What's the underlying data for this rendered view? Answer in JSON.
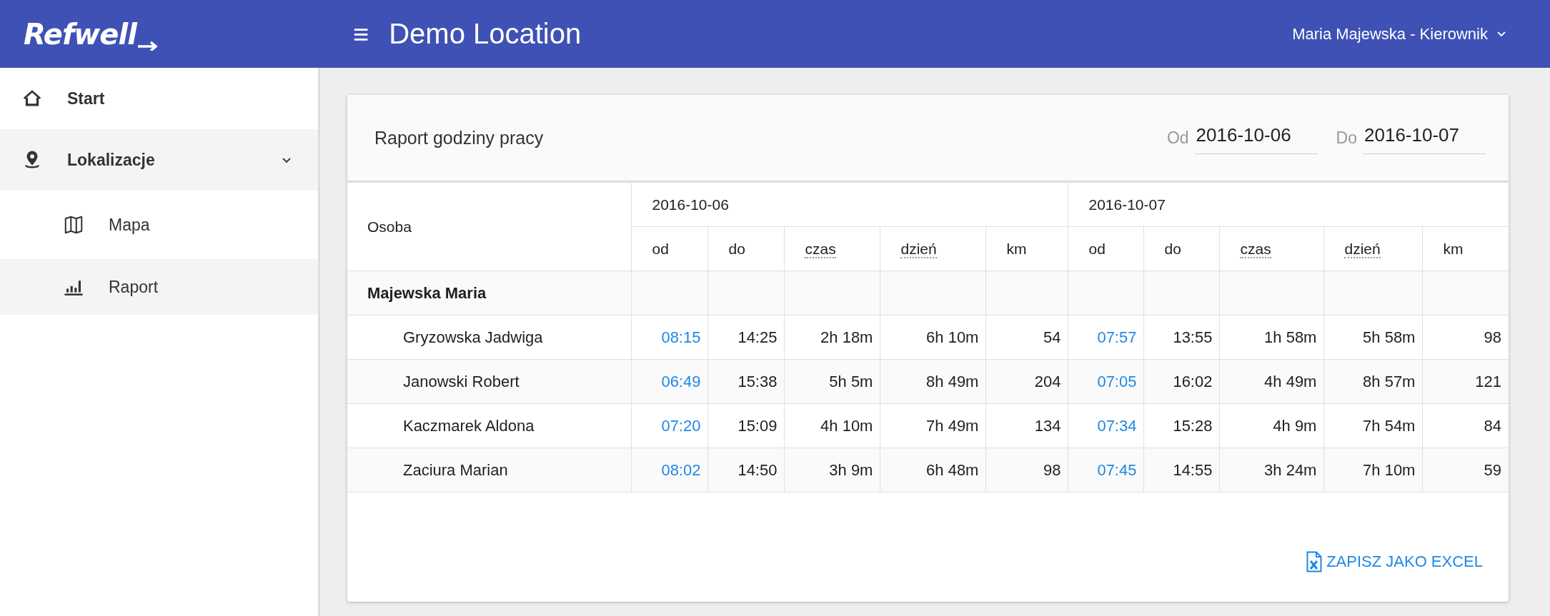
{
  "header": {
    "logo": "Refwell",
    "menu_icon": "≡",
    "title": "Demo Location",
    "user": "Maria Majewska - Kierownik"
  },
  "sidebar": {
    "items": [
      {
        "label": "Start",
        "kind": "home",
        "selected": false
      },
      {
        "label": "Lokalizacje",
        "kind": "pin",
        "selected": false,
        "expanded": true,
        "children": [
          {
            "label": "Mapa",
            "kind": "map",
            "selected": false
          },
          {
            "label": "Raport",
            "kind": "chart",
            "selected": true
          }
        ]
      }
    ]
  },
  "report": {
    "title": "Raport godziny pracy",
    "from": {
      "label": "Od",
      "value": "2016-10-06"
    },
    "to": {
      "label": "Do",
      "value": "2016-10-07"
    },
    "table": {
      "person_header": "Osoba",
      "days": [
        {
          "date": "2016-10-06",
          "columns": [
            {
              "label": "od",
              "kind": "plain"
            },
            {
              "label": "do",
              "kind": "plain"
            },
            {
              "label": "czas",
              "kind": "hint"
            },
            {
              "label": "dzień",
              "kind": "hint"
            },
            {
              "label": "km",
              "kind": "plain"
            }
          ]
        },
        {
          "date": "2016-10-07",
          "columns": [
            {
              "label": "od",
              "kind": "plain"
            },
            {
              "label": "do",
              "kind": "plain"
            },
            {
              "label": "czas",
              "kind": "hint"
            },
            {
              "label": "dzień",
              "kind": "hint"
            },
            {
              "label": "km",
              "kind": "plain"
            }
          ]
        }
      ],
      "rows": [
        {
          "kind": "group",
          "name": "Majewska Maria",
          "cells": []
        },
        {
          "kind": "person",
          "name": "Gryzowska Jadwiga",
          "cells": [
            "08:15",
            "14:25",
            "2h 18m",
            "6h 10m",
            "54",
            "07:57",
            "13:55",
            "1h 58m",
            "5h 58m",
            "98"
          ]
        },
        {
          "kind": "person",
          "name": "Janowski Robert",
          "cells": [
            "06:49",
            "15:38",
            "5h 5m",
            "8h 49m",
            "204",
            "07:05",
            "16:02",
            "4h 49m",
            "8h 57m",
            "121"
          ]
        },
        {
          "kind": "person",
          "name": "Kaczmarek Aldona",
          "cells": [
            "07:20",
            "15:09",
            "4h 10m",
            "7h 49m",
            "134",
            "07:34",
            "15:28",
            "4h 9m",
            "7h 54m",
            "84"
          ]
        },
        {
          "kind": "person",
          "name": "Zaciura Marian",
          "cells": [
            "08:02",
            "14:50",
            "3h 9m",
            "6h 48m",
            "98",
            "07:45",
            "14:55",
            "3h 24m",
            "7h 10m",
            "59"
          ]
        }
      ]
    },
    "export_button": "ZAPISZ JAKO EXCEL"
  }
}
